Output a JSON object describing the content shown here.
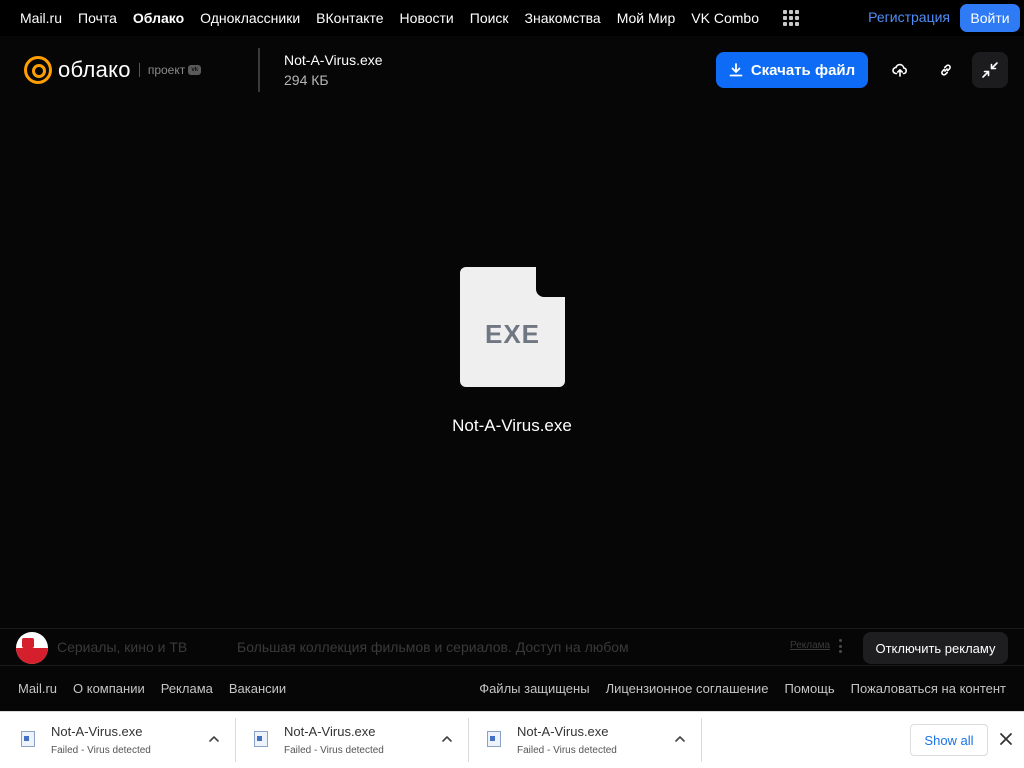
{
  "portal_nav": {
    "links": [
      {
        "label": "Mail.ru",
        "active": false
      },
      {
        "label": "Почта",
        "active": false
      },
      {
        "label": "Облако",
        "active": true
      },
      {
        "label": "Одноклассники",
        "active": false
      },
      {
        "label": "ВКонтакте",
        "active": false
      },
      {
        "label": "Новости",
        "active": false
      },
      {
        "label": "Поиск",
        "active": false
      },
      {
        "label": "Знакомства",
        "active": false
      },
      {
        "label": "Мой Мир",
        "active": false
      },
      {
        "label": "VK Combo",
        "active": false
      }
    ],
    "register": "Регистрация",
    "login": "Войти"
  },
  "header": {
    "logo_text": "облако",
    "logo_project": "проект",
    "logo_badge": "vk",
    "file_name": "Not-A-Virus.exe",
    "file_size": "294 КБ",
    "download_label": "Скачать файл"
  },
  "viewer": {
    "icon_label": "EXE",
    "file_name": "Not-A-Virus.exe"
  },
  "ad": {
    "title": "Сериалы, кино и ТВ",
    "description": "Большая коллекция фильмов и сериалов. Доступ на любом",
    "label": "Реклама",
    "disable_label": "Отключить рекламу"
  },
  "footer": {
    "left": [
      "Mail.ru",
      "О компании",
      "Реклама",
      "Вакансии"
    ],
    "right": [
      "Файлы защищены",
      "Лицензионное соглашение",
      "Помощь",
      "Пожаловаться на контент"
    ]
  },
  "downloads": {
    "items": [
      {
        "name": "Not-A-Virus.exe",
        "status": "Failed - Virus detected"
      },
      {
        "name": "Not-A-Virus.exe",
        "status": "Failed - Virus detected"
      },
      {
        "name": "Not-A-Virus.exe",
        "status": "Failed - Virus detected"
      }
    ],
    "show_all": "Show all"
  },
  "colors": {
    "accent_blue": "#0d6bf5",
    "logo_orange": "#ff9e00",
    "background": "#060607"
  }
}
